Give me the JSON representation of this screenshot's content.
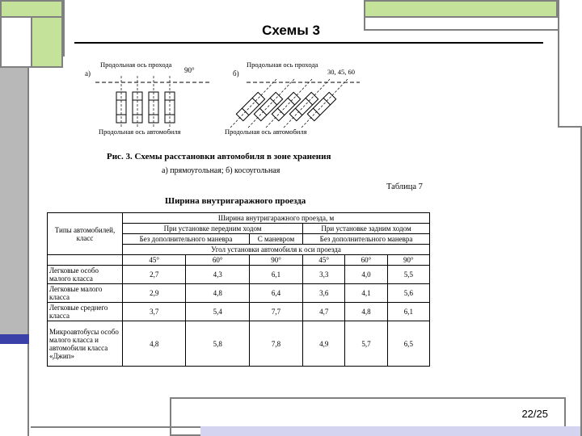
{
  "slide": {
    "title": "Схемы 3",
    "page_number": "22/25"
  },
  "figure": {
    "label_a": "а)",
    "label_b": "б)",
    "a_axis_passage": "Продольная ось прохода",
    "a_angle": "90°",
    "a_axis_car": "Продольная ось автомобиля",
    "b_axis_passage": "Продольная ось прохода",
    "b_angles": "30, 45, 60",
    "b_axis_car": "Продольная ось автомобиля",
    "caption": "Рис. 3. Схемы расстановки автомобиля в зоне хранения",
    "subcaption": "а) прямоугольная; б) косоугольная"
  },
  "table": {
    "label": "Таблица 7",
    "title": "Ширина внутригаражного проезда",
    "header_main": "Ширина внутригаражного проезда, м",
    "row_header": "Типы автомобилей, класс",
    "front_group": "При установке передним ходом",
    "rear_group": "При установке задним ходом",
    "no_maneuver_front": "Без дополнительного маневра",
    "with_maneuver": "С маневром",
    "no_maneuver_rear": "Без дополнительного маневра",
    "angle_header": "Угол установки автомобиля к оси проезда",
    "angles": [
      "45°",
      "60°",
      "90°",
      "45°",
      "60°",
      "90°"
    ],
    "rows": [
      {
        "type": "Легковые особо малого класса",
        "values": [
          "2,7",
          "4,3",
          "6,1",
          "3,3",
          "4,0",
          "5,5"
        ]
      },
      {
        "type": "Легковые малого класса",
        "values": [
          "2,9",
          "4,8",
          "6,4",
          "3,6",
          "4,1",
          "5,6"
        ]
      },
      {
        "type": "Легковые среднего класса",
        "values": [
          "3,7",
          "5,4",
          "7,7",
          "4,7",
          "4,8",
          "6,1"
        ]
      },
      {
        "type": "Микроавтобусы особо малого класса и автомобили класса «Джип»",
        "values": [
          "4,8",
          "5,8",
          "7,8",
          "4,9",
          "5,7",
          "6,5"
        ]
      }
    ]
  },
  "colors": {
    "accent_green": "#c4e29a",
    "accent_gray": "#b8b8b8",
    "accent_blue": "#3b3fa8",
    "accent_lavender": "#d4d4f0"
  }
}
